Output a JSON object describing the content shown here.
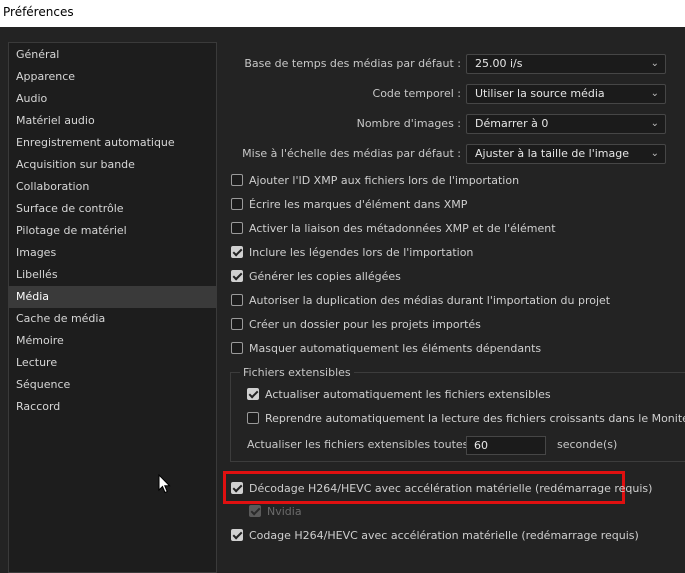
{
  "window": {
    "title": "Préférences"
  },
  "sidebar": {
    "items": [
      {
        "label": "Général"
      },
      {
        "label": "Apparence"
      },
      {
        "label": "Audio"
      },
      {
        "label": "Matériel audio"
      },
      {
        "label": "Enregistrement automatique"
      },
      {
        "label": "Acquisition sur bande"
      },
      {
        "label": "Collaboration"
      },
      {
        "label": "Surface de contrôle"
      },
      {
        "label": "Pilotage de matériel"
      },
      {
        "label": "Images"
      },
      {
        "label": "Libellés"
      },
      {
        "label": "Média"
      },
      {
        "label": "Cache de média"
      },
      {
        "label": "Mémoire"
      },
      {
        "label": "Lecture"
      },
      {
        "label": "Séquence"
      },
      {
        "label": "Raccord"
      }
    ],
    "selected": "Média"
  },
  "settings": {
    "timebase": {
      "label": "Base de temps des médias par défaut :",
      "value": "25.00  i/s"
    },
    "timecode": {
      "label": "Code temporel :",
      "value": "Utiliser la source média"
    },
    "frame_count": {
      "label": "Nombre d'images :",
      "value": "Démarrer à 0"
    },
    "scaling": {
      "label": "Mise à l'échelle des médias par défaut :",
      "value": "Ajuster à la taille de l'image"
    }
  },
  "checkboxes": {
    "xmp_id": {
      "label": "Ajouter l'ID XMP aux fichiers lors de l'importation",
      "checked": false
    },
    "write_clip_markers": {
      "label": "Écrire les marques d'élément dans XMP",
      "checked": false
    },
    "xmp_link": {
      "label": "Activer la liaison des métadonnées XMP et de l'élément",
      "checked": false
    },
    "captions": {
      "label": "Inclure les légendes lors de l'importation",
      "checked": true
    },
    "peak_files": {
      "label": "Générer les copies allégées",
      "checked": true
    },
    "duplicate": {
      "label": "Autoriser la duplication des médias durant l'importation du projet",
      "checked": false
    },
    "folder": {
      "label": "Créer un dossier pour les projets importés",
      "checked": false
    },
    "hide_dependents": {
      "label": "Masquer automatiquement les éléments dépendants",
      "checked": false
    }
  },
  "growing_files": {
    "legend": "Fichiers extensibles",
    "auto_refresh": {
      "label": "Actualiser automatiquement les fichiers extensibles",
      "checked": true
    },
    "resume_playback": {
      "label": "Reprendre automatiquement la lecture des fichiers croissants dans le Moniteur source",
      "checked": false
    },
    "interval_label": "Actualiser les fichiers extensibles toutes les",
    "interval_value": "60",
    "interval_unit": "seconde(s)"
  },
  "hardware": {
    "decode": {
      "label": "Décodage H264/HEVC avec accélération matérielle (redémarrage requis)",
      "checked": true
    },
    "nvidia": {
      "label": "Nvidia",
      "checked": true,
      "disabled": true
    },
    "encode": {
      "label": "Codage H264/HEVC avec accélération matérielle (redémarrage requis)",
      "checked": true
    }
  },
  "colors": {
    "highlight": "#e01010",
    "background": "#232323",
    "sidebar": "#1d1d1d"
  }
}
